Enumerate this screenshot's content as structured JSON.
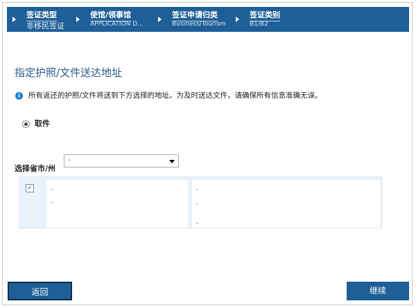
{
  "breadcrumb": [
    {
      "title": "签证类型",
      "subtitle": "非移民签证"
    },
    {
      "title": "使馆/领事馆",
      "subtitle": "APPLICATION D..."
    },
    {
      "title": "签证申请归类",
      "subtitle": "Business/Tourism"
    },
    {
      "title": "签证类别",
      "subtitle": "B1/B2"
    }
  ],
  "page": {
    "title": "指定护照/文件送达地址",
    "info_text": "所有返还的护照/文件将送到下方选择的地址。为及时送达文件，请确保所有信息准确无误。"
  },
  "delivery_option": {
    "label": "取件",
    "selected": true
  },
  "province": {
    "label": "选择省市/州",
    "selected_value": "-"
  },
  "address_list": [
    {
      "checked": true,
      "col1": [
        "-",
        "-"
      ],
      "col2": [
        "-",
        "-",
        "-"
      ]
    }
  ],
  "buttons": {
    "back": "返回",
    "next": "继续"
  },
  "colors": {
    "header_bg": "#1f5f97",
    "title_color": "#2b5c8a",
    "row_bg": "#eaf3fb"
  }
}
